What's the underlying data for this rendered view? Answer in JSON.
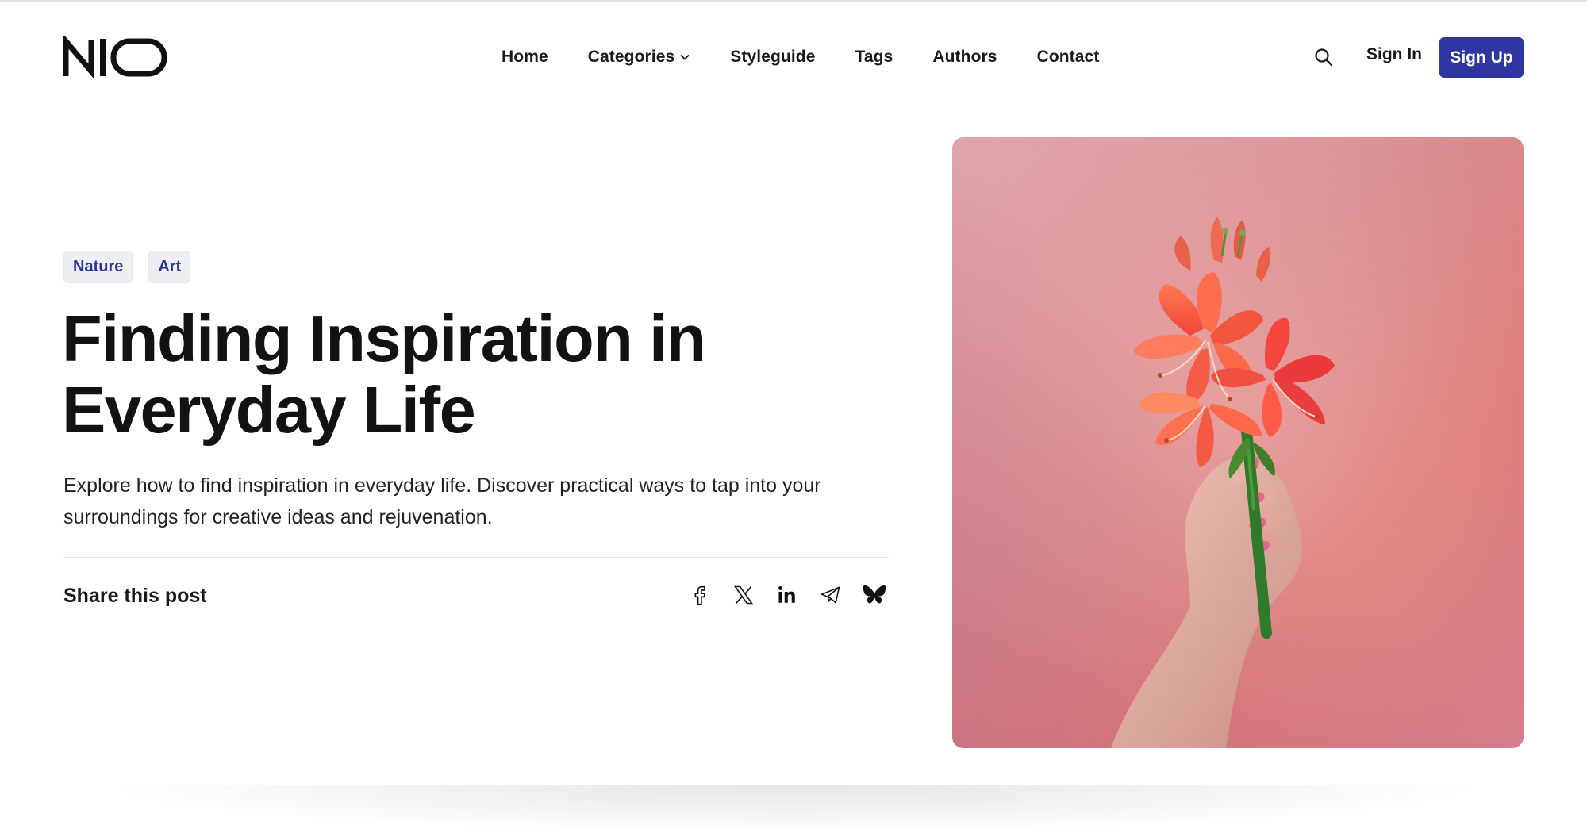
{
  "header": {
    "logo_text": "NIO",
    "nav": [
      {
        "label": "Home"
      },
      {
        "label": "Categories"
      },
      {
        "label": "Styleguide"
      },
      {
        "label": "Tags"
      },
      {
        "label": "Authors"
      },
      {
        "label": "Contact"
      }
    ],
    "sign_in_label": "Sign In",
    "sign_up_label": "Sign Up"
  },
  "post": {
    "tags": [
      "Nature",
      "Art"
    ],
    "title": "Finding Inspiration in Everyday Life",
    "excerpt": "Explore how to find inspiration in everyday life. Discover practical ways to tap into your surroundings for creative ideas and rejuvenation.",
    "share_label": "Share this post",
    "share_icons": [
      "facebook-icon",
      "x-icon",
      "linkedin-icon",
      "telegram-icon",
      "bluesky-icon"
    ]
  },
  "colors": {
    "accent": "#2f35a1",
    "tag_bg": "#eeeff4",
    "tag_text": "#2b3491"
  }
}
